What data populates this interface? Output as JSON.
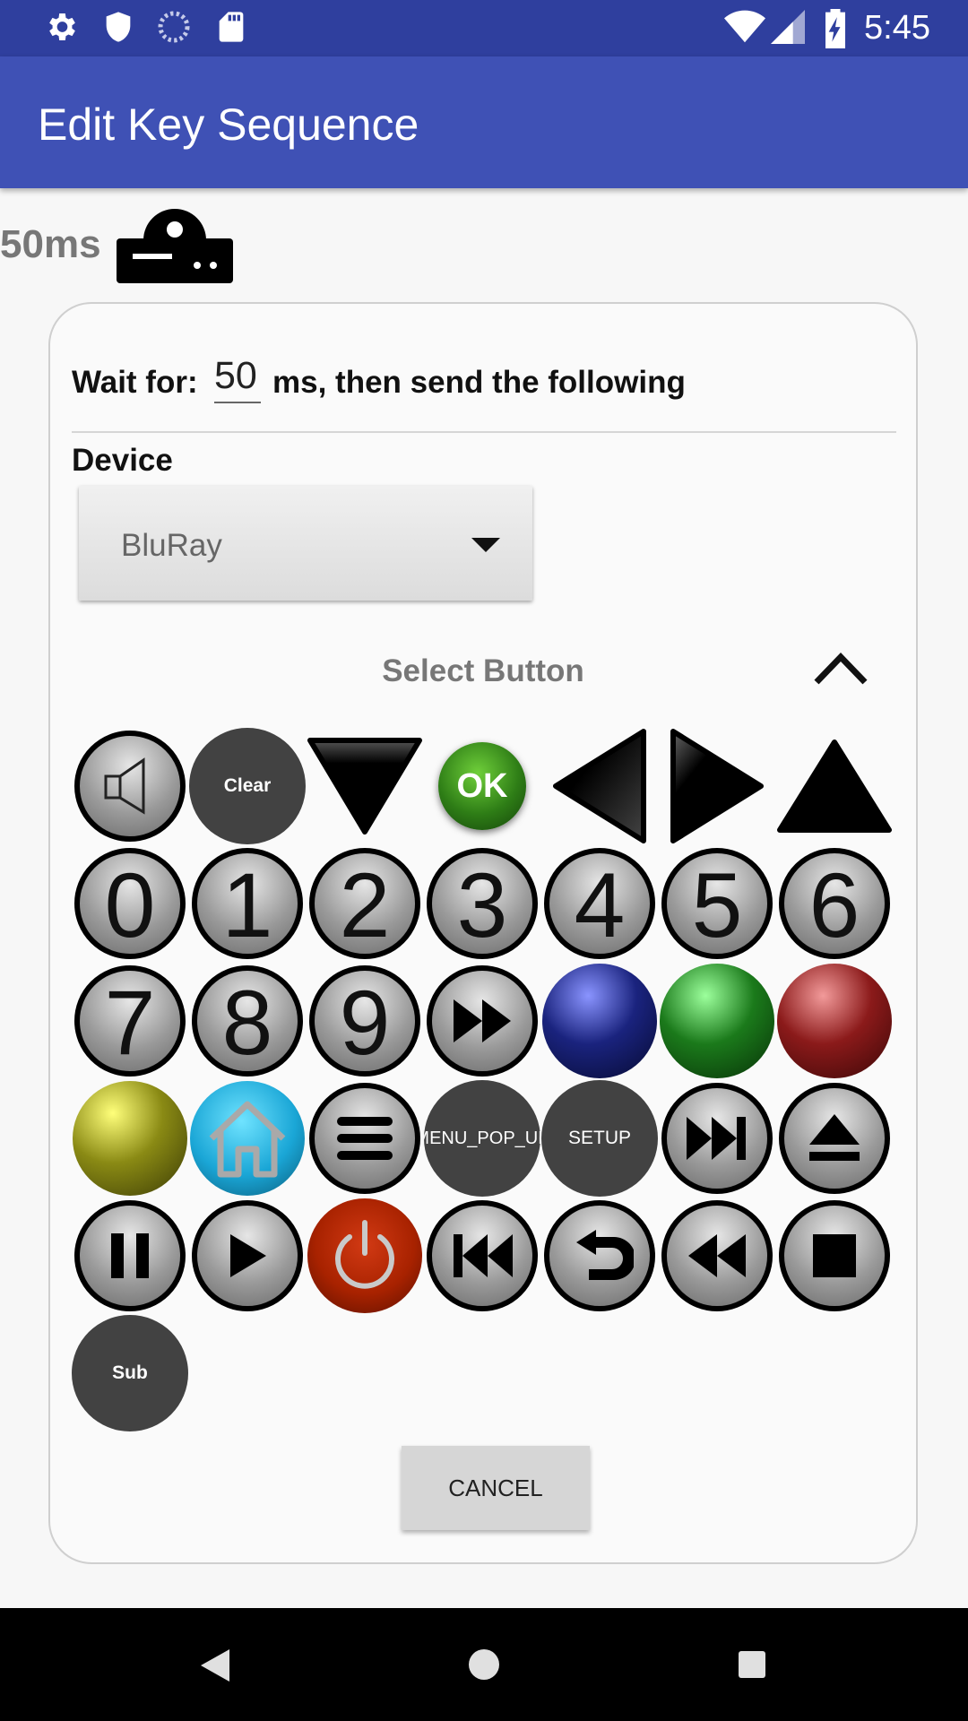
{
  "status_bar": {
    "time": "5:45"
  },
  "app_bar": {
    "title": "Edit Key Sequence"
  },
  "header": {
    "delay_text": "50ms"
  },
  "dialog": {
    "wait_label": "Wait for:",
    "wait_value": "50",
    "wait_suffix": "ms, then send the following",
    "device_label": "Device",
    "device_selected": "BluRay",
    "select_title": "Select Button",
    "cancel_label": "CANCEL"
  },
  "buttons": {
    "clear": "Clear",
    "ok": "OK",
    "d0": "0",
    "d1": "1",
    "d2": "2",
    "d3": "3",
    "d4": "4",
    "d5": "5",
    "d6": "6",
    "d7": "7",
    "d8": "8",
    "d9": "9",
    "menu_popup": "MENU_POP_UP",
    "setup": "SETUP",
    "sub": "Sub"
  },
  "icons": {
    "mute": "speaker-mute-icon",
    "down": "arrow-down-icon",
    "left": "arrow-left-icon",
    "right": "arrow-right-icon",
    "up": "arrow-up-icon",
    "fast_forward": "fast-forward-icon",
    "home": "home-icon",
    "menu": "menu-icon",
    "next": "skip-next-icon",
    "eject": "eject-icon",
    "pause": "pause-icon",
    "play": "play-icon",
    "power": "power-icon",
    "previous": "skip-previous-icon",
    "back": "return-icon",
    "rewind": "rewind-icon",
    "stop": "stop-icon"
  },
  "colors": {
    "status_bar": "#2f3f9e",
    "app_bar": "#3f51b5",
    "blue_ball": "#1a237e",
    "green_ball": "#1b7a1b",
    "red_ball": "#8b1a1a",
    "yellow_ball": "#8a8a14",
    "ok_green": "#2e7d16"
  }
}
